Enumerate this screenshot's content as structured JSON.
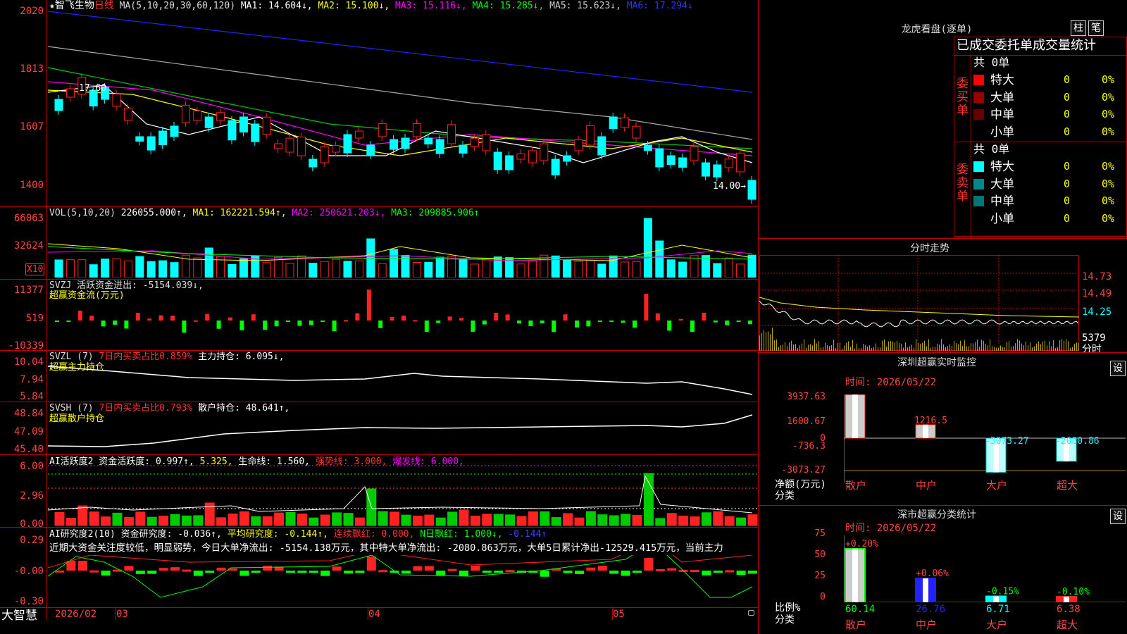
{
  "stock": {
    "star": "★",
    "name": "智飞生物",
    "period": "日线"
  },
  "kline": {
    "ma_legend": "MA(5,10,20,30,60,120)",
    "ma1": "MA1: 14.604↓,",
    "ma2": "MA2: 15.100↓,",
    "ma3": "MA3: 15.116↓,",
    "ma4": "MA4: 15.285↓,",
    "ma5": "MA5: 15.623↓,",
    "ma6": "MA6: 17.294↓",
    "y_labels": [
      "2020",
      "1813",
      "1607",
      "1400"
    ],
    "high_mark": "17.60",
    "low_mark": "14.00→"
  },
  "vol": {
    "legend": "VOL(5,10,20)",
    "value": "226055.000↑,",
    "ma1": "MA1: 162221.594↑,",
    "ma2": "MA2: 250621.203↓,",
    "ma3": "MA3: 209885.906↑",
    "y_labels": [
      "66063",
      "32624"
    ],
    "unit": "X10"
  },
  "svzj": {
    "legend": "SVZJ  活跃资金进出: -5154.039↓,",
    "sub": "超赢资金流(万元)",
    "y_labels": [
      "11377",
      "519",
      "-10339"
    ]
  },
  "svzl": {
    "legend": "SVZL (7)",
    "pct": "7日内买卖占比0.859%",
    "hold": "主力持仓: 6.095↓,",
    "sub": "超赢主力持仓",
    "y_labels": [
      "10.04",
      "7.94",
      "5.84"
    ]
  },
  "svsh": {
    "legend": "SVSH (7)",
    "pct": "7日内买卖占比0.793%",
    "hold": "散户持仓: 48.641↑,",
    "sub": "超赢散户持仓",
    "y_labels": [
      "48.84",
      "47.09",
      "45.40"
    ]
  },
  "ai_active": {
    "legend": "AI活跃度2 资金活跃度: 0.997↑,",
    "v2": "5.325,",
    "life": "生命线: 1.560,",
    "strong": "强势线: 3.000,",
    "burst": "爆发线: 6.000,",
    "y_labels": [
      "6.00",
      "2.96",
      "0.00"
    ]
  },
  "ai_research": {
    "legend": "AI研究度2(10) 资金研究度: -0.036↑,",
    "avg": "平均研究度: -0.144↑,",
    "cont": "连续飘红: 0.000,",
    "nday": "N日飘红: 1.000↓,",
    "last": "-0.144↑",
    "comment": "近期大资金关注度较低，明显弱势，今日大单净流出: -5154.138万元，其中特大单净流出: -2080.863万元，大单5日累计净出-12529.415万元，当前主力",
    "y_labels": [
      "0.29",
      "-0.00",
      "-0.30"
    ]
  },
  "bottom": {
    "brand": "大智慧",
    "dates": [
      "2026/02",
      "03",
      "04",
      "05"
    ]
  },
  "dragon": {
    "title": "龙虎看盘(逐单)",
    "btn1": "柱",
    "btn2": "笔",
    "stat_title": "已成交委托单成交量统计",
    "buy_label": "委买单",
    "sell_label": "委卖单",
    "buy_total": "共 0单",
    "sell_total": "共 0单",
    "rows": [
      {
        "name": "特大",
        "n": "0",
        "p": "0%"
      },
      {
        "name": "大单",
        "n": "0",
        "p": "0%"
      },
      {
        "name": "中单",
        "n": "0",
        "p": "0%"
      },
      {
        "name": "小单",
        "n": "0",
        "p": "0%"
      }
    ],
    "colors": {
      "buy": [
        "#ff0000",
        "#990000",
        "#660000"
      ],
      "sell": [
        "#00ffff",
        "#008888",
        "#007777"
      ]
    }
  },
  "intraday": {
    "title": "分时走势",
    "prices": [
      "14.73",
      "14.49",
      "14.25"
    ],
    "vol": "5379",
    "vol_unit": "分时"
  },
  "sz_monitor": {
    "title": "深圳超赢实时监控",
    "btn": "设",
    "time": "时间: 2026/05/22",
    "y_labels": [
      "3937.63",
      "1600.67",
      "0",
      "-736.3",
      "-3073.27"
    ],
    "net_label": "净额(万元)",
    "cat_label": "分类",
    "categories": [
      "散户",
      "中户",
      "大户",
      "超大"
    ],
    "values": [
      3937.63,
      1216.5,
      -3073.27,
      -2080.86
    ],
    "value_labels": [
      "3937.63",
      "1216.5",
      "-3073.27",
      "-2080.86"
    ]
  },
  "sz_class": {
    "title": "深市超赢分类统计",
    "btn": "设",
    "time": "时间: 2026/05/22",
    "y_labels": [
      "75",
      "50",
      "25",
      "0"
    ],
    "ratio_label": "比例%",
    "cat_label": "分类",
    "categories": [
      "散户",
      "中户",
      "大户",
      "超大"
    ],
    "values": [
      60.14,
      26.76,
      6.71,
      6.38
    ],
    "value_labels": [
      "60.14",
      "26.76",
      "6.71",
      "6.38"
    ],
    "changes": [
      "+0.20%",
      "+0.06%",
      "-0.15%",
      "-0.10%"
    ]
  }
}
